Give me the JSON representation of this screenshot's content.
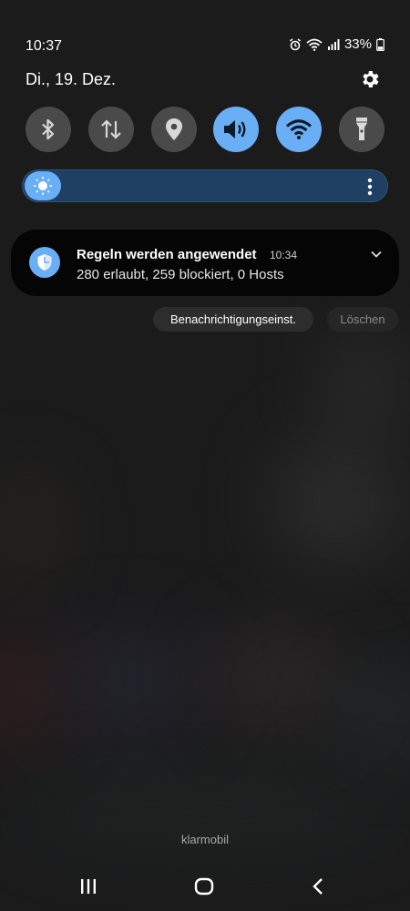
{
  "status_bar": {
    "time": "10:37",
    "battery_percent": "33%",
    "icons": [
      "alarm-icon",
      "wifi-icon",
      "signal-icon",
      "battery-icon"
    ]
  },
  "header": {
    "date": "Di., 19. Dez.",
    "settings_icon": "gear-icon"
  },
  "quick_settings": {
    "accent_color": "#6aaef5",
    "tiles": [
      {
        "icon": "bluetooth-icon",
        "active": false
      },
      {
        "icon": "mobile-data-icon",
        "active": false
      },
      {
        "icon": "location-icon",
        "active": false
      },
      {
        "icon": "sound-icon",
        "active": true
      },
      {
        "icon": "wifi-icon",
        "active": true
      },
      {
        "icon": "flashlight-icon",
        "active": false
      }
    ]
  },
  "brightness": {
    "level_fraction": 0.05,
    "icon": "sun-icon",
    "more_icon": "more-vertical-icon"
  },
  "notification": {
    "icon": "shield-icon",
    "title": "Regeln werden angewendet",
    "time": "10:34",
    "body": "280 erlaubt, 259 blockiert, 0 Hosts"
  },
  "actions": {
    "settings_label": "Benachrichtigungseinst.",
    "clear_label": "Löschen"
  },
  "carrier": "klarmobil",
  "navigation": {
    "recents_icon": "recents-icon",
    "home_icon": "home-icon",
    "back_icon": "back-icon"
  }
}
